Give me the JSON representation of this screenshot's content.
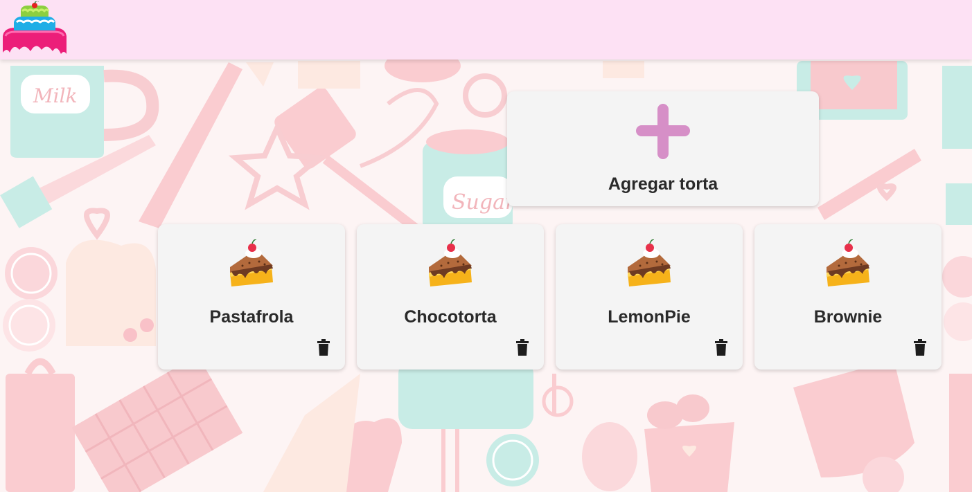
{
  "header": {
    "logo_icon": "cake-logo-icon",
    "background_color": "#fde1f4"
  },
  "add_card": {
    "label": "Agregar torta",
    "icon": "plus-icon",
    "icon_color": "#d68fc7"
  },
  "pies": [
    {
      "name": "Pastafrola",
      "icon": "cake-slice-icon",
      "action_icon": "trash-icon"
    },
    {
      "name": "Chocotorta",
      "icon": "cake-slice-icon",
      "action_icon": "trash-icon"
    },
    {
      "name": "LemonPie",
      "icon": "cake-slice-icon",
      "action_icon": "trash-icon"
    },
    {
      "name": "Brownie",
      "icon": "cake-slice-icon",
      "action_icon": "trash-icon"
    }
  ],
  "background_pattern": {
    "milk_label": "Milk",
    "sugar_label": "Sugar"
  }
}
